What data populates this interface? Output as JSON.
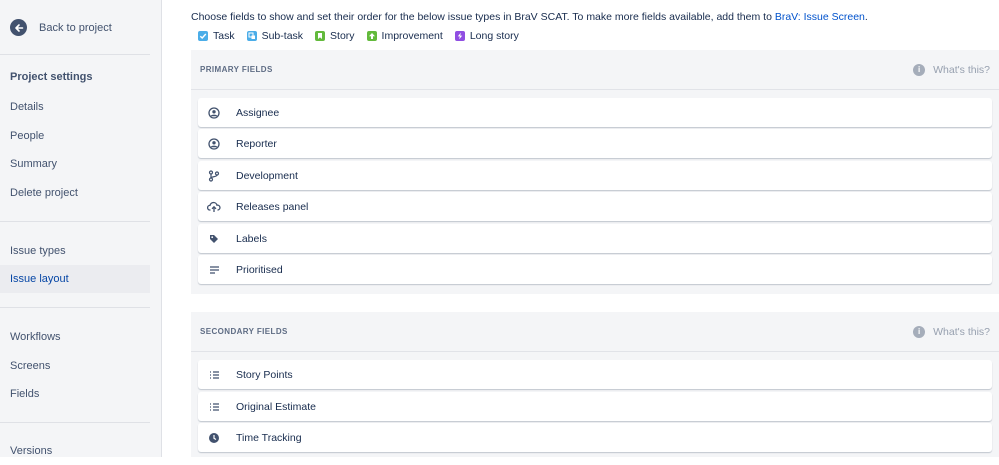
{
  "sidebar": {
    "back_label": "Back to project",
    "section_title": "Project settings",
    "items": [
      "Details",
      "People",
      "Summary",
      "Delete project"
    ],
    "issue_items": [
      "Issue types",
      "Issue layout"
    ],
    "workflow_items": [
      "Workflows",
      "Screens",
      "Fields"
    ],
    "more_items": [
      "Versions"
    ],
    "active_item": "Issue layout"
  },
  "main": {
    "intro_text": "Choose fields to show and set their order for the below issue types in BraV SCAT. To make more fields available, add them to ",
    "intro_link": "BraV: Issue Screen",
    "intro_end": ".",
    "issue_types": [
      {
        "label": "Task",
        "color": "#4bade8",
        "icon": "check-icon"
      },
      {
        "label": "Sub-task",
        "color": "#4bade8",
        "icon": "subtask-icon"
      },
      {
        "label": "Story",
        "color": "#63ba3c",
        "icon": "bookmark-icon"
      },
      {
        "label": "Improvement",
        "color": "#63ba3c",
        "icon": "arrow-up-icon"
      },
      {
        "label": "Long story",
        "color": "#904ee2",
        "icon": "bolt-icon"
      }
    ],
    "primary": {
      "title": "PRIMARY FIELDS",
      "help": "What's this?",
      "fields": [
        {
          "label": "Assignee",
          "icon": "user-icon"
        },
        {
          "label": "Reporter",
          "icon": "user-icon"
        },
        {
          "label": "Development",
          "icon": "branch-icon"
        },
        {
          "label": "Releases panel",
          "icon": "cloud-upload-icon"
        },
        {
          "label": "Labels",
          "icon": "tag-icon"
        },
        {
          "label": "Prioritised",
          "icon": "text-lines-icon"
        }
      ]
    },
    "secondary": {
      "title": "SECONDARY FIELDS",
      "help": "What's this?",
      "fields": [
        {
          "label": "Story Points",
          "icon": "list-icon"
        },
        {
          "label": "Original Estimate",
          "icon": "list-icon"
        },
        {
          "label": "Time Tracking",
          "icon": "clock-icon"
        }
      ]
    }
  }
}
